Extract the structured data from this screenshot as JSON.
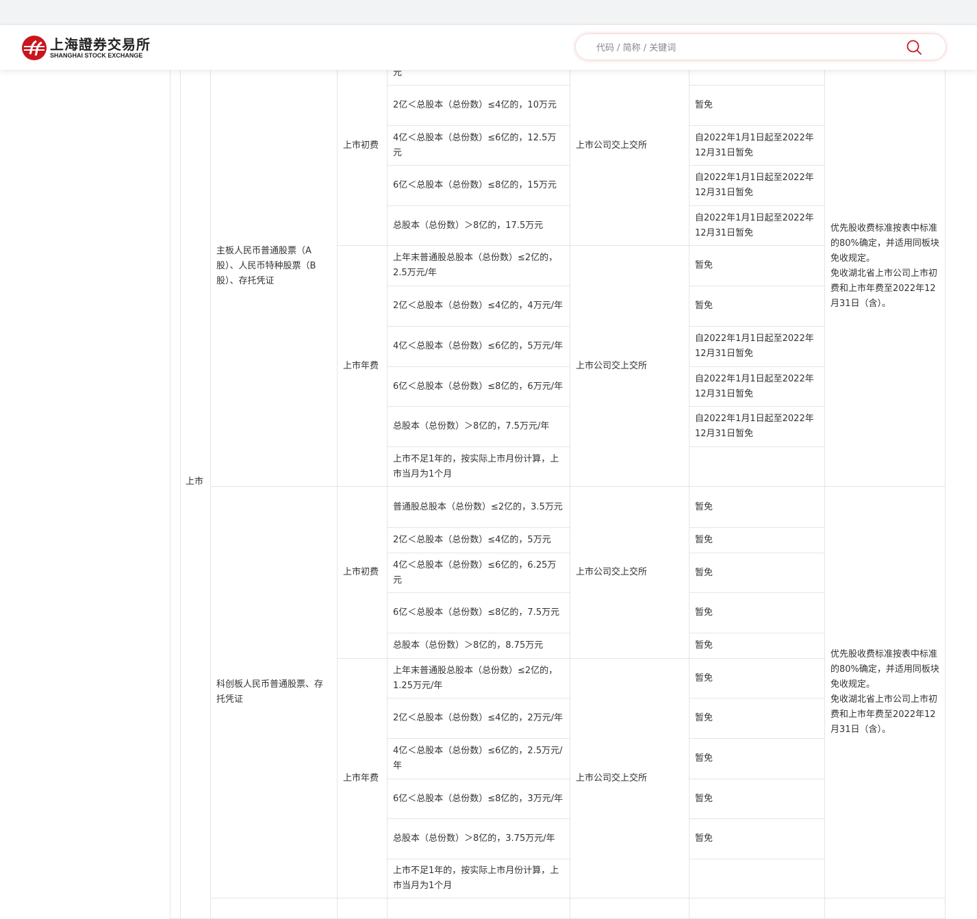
{
  "header": {
    "logo_cn": "上海證券交易所",
    "logo_en": "SHANGHAI STOCK EXCHANGE",
    "search_placeholder": "代码 / 简称 / 关键词",
    "search_icon": "search-icon",
    "accent_color": "#c8161d"
  },
  "table": {
    "category": "上市",
    "blocks": [
      {
        "label": "主板人民币普通股票（A股）、人民币特种股票（B股）、存托凭证",
        "notes": [
          "优先股收费标准按表中标准的80%确定，并适用同板块免收规定。",
          "免收湖北省上市公司上市初费和上市年费至2022年12月31日（含）。"
        ],
        "groups": [
          {
            "name": "上市初费",
            "payer": "上市公司交上交所",
            "rows": [
              {
                "standard": "元",
                "exemption": ""
              },
              {
                "standard": "2亿＜总股本（总份数）≤4亿的，10万元",
                "exemption": "暂免"
              },
              {
                "standard": "4亿＜总股本（总份数）≤6亿的，12.5万元",
                "exemption": "自2022年1月1日起至2022年12月31日暂免"
              },
              {
                "standard": "6亿＜总股本（总份数）≤8亿的，15万元",
                "exemption": "自2022年1月1日起至2022年12月31日暂免"
              },
              {
                "standard": "总股本（总份数）＞8亿的，17.5万元",
                "exemption": "自2022年1月1日起至2022年12月31日暂免"
              }
            ]
          },
          {
            "name": "上市年费",
            "payer": "上市公司交上交所",
            "rows": [
              {
                "standard": "上年末普通股总股本（总份数）≤2亿的，2.5万元/年",
                "exemption": "暂免"
              },
              {
                "standard": "2亿＜总股本（总份数）≤4亿的，4万元/年",
                "exemption": "暂免"
              },
              {
                "standard": "4亿＜总股本（总份数）≤6亿的，5万元/年",
                "exemption": "自2022年1月1日起至2022年12月31日暂免"
              },
              {
                "standard": "6亿＜总股本（总份数）≤8亿的，6万元/年",
                "exemption": "自2022年1月1日起至2022年12月31日暂免"
              },
              {
                "standard": "总股本（总份数）＞8亿的，7.5万元/年",
                "exemption": "自2022年1月1日起至2022年12月31日暂免"
              },
              {
                "standard": "上市不足1年的，按实际上市月份计算，上市当月为1个月",
                "exemption": ""
              }
            ]
          }
        ]
      },
      {
        "label": "科创板人民币普通股票、存托凭证",
        "notes": [
          "优先股收费标准按表中标准的80%确定，并适用同板块免收规定。",
          "免收湖北省上市公司上市初费和上市年费至2022年12月31日（含）。"
        ],
        "groups": [
          {
            "name": "上市初费",
            "payer": "上市公司交上交所",
            "rows": [
              {
                "standard": "普通股总股本（总份数）≤2亿的，3.5万元",
                "exemption": "暂免"
              },
              {
                "standard": "2亿＜总股本（总份数）≤4亿的，5万元",
                "exemption": "暂免"
              },
              {
                "standard": "4亿＜总股本（总份数）≤6亿的，6.25万元",
                "exemption": "暂免"
              },
              {
                "standard": "6亿＜总股本（总份数）≤8亿的，7.5万元",
                "exemption": "暂免"
              },
              {
                "standard": "总股本（总份数）＞8亿的，8.75万元",
                "exemption": "暂免"
              }
            ]
          },
          {
            "name": "上市年费",
            "payer": "上市公司交上交所",
            "rows": [
              {
                "standard": "上年末普通股总股本（总份数）≤2亿的，1.25万元/年",
                "exemption": "暂免"
              },
              {
                "standard": "2亿＜总股本（总份数）≤4亿的，2万元/年",
                "exemption": "暂免"
              },
              {
                "standard": "4亿＜总股本（总份数）≤6亿的，2.5万元/年",
                "exemption": "暂免"
              },
              {
                "standard": "6亿＜总股本（总份数）≤8亿的，3万元/年",
                "exemption": "暂免"
              },
              {
                "standard": "总股本（总份数）＞8亿的，3.75万元/年",
                "exemption": "暂免"
              },
              {
                "standard": "上市不足1年的，按实际上市月份计算，上市当月为1个月",
                "exemption": ""
              }
            ]
          }
        ]
      }
    ]
  }
}
